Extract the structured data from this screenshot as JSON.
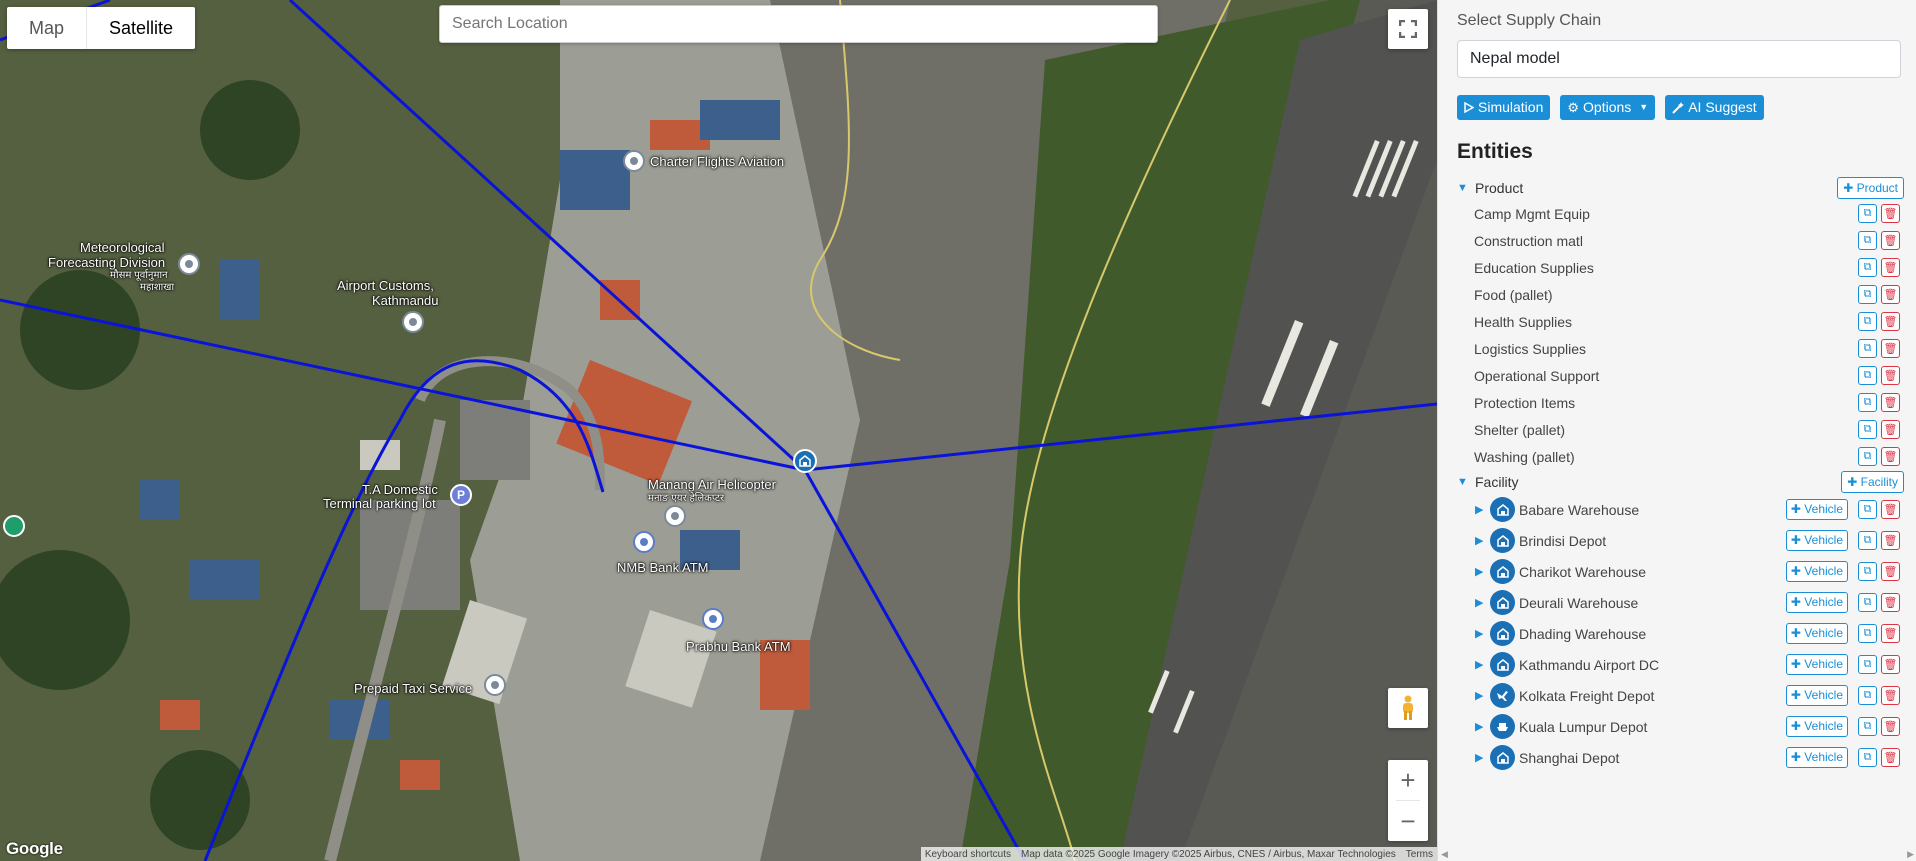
{
  "map": {
    "toggle": {
      "map": "Map",
      "satellite": "Satellite"
    },
    "search_placeholder": "Search Location",
    "labels": {
      "charter": "Charter Flights Aviation",
      "met_line1": "Meteorological",
      "met_line2": "Forecasting Division",
      "met_line3": "मौसम पूर्वानुमान",
      "met_line4": "महाशाखा",
      "customs_line1": "Airport Customs,",
      "customs_line2": "Kathmandu",
      "domestic_line1": "T.A Domestic",
      "domestic_line2": "Terminal parking lot",
      "manang_line1": "Manang Air Helicopter",
      "manang_line2": "मनाङ एयर हेलिकप्टर",
      "nmb": "NMB Bank ATM",
      "prabhu": "Prabhu Bank ATM",
      "taxi": "Prepaid Taxi Service"
    },
    "parking_glyph": "P",
    "google_logo": "Google",
    "attribution": {
      "shortcuts": "Keyboard shortcuts",
      "data": "Map data ©2025 Google Imagery ©2025 Airbus, CNES / Airbus, Maxar Technologies",
      "terms": "Terms"
    },
    "controls": {
      "zoom_in": "+",
      "zoom_out": "−"
    },
    "route_color": "#0a14d8",
    "facility_marker_color": "#1a6fb5"
  },
  "panel": {
    "select_label": "Select Supply Chain",
    "selected_chain": "Nepal model",
    "buttons": {
      "simulation": "Simulation",
      "options": "Options",
      "ai_suggest": "AI Suggest"
    },
    "entities_title": "Entities",
    "product_section": {
      "title": "Product",
      "add_label": "Product"
    },
    "products": [
      "Camp Mgmt Equip",
      "Construction matl",
      "Education Supplies",
      "Food (pallet)",
      "Health Supplies",
      "Logistics Supplies",
      "Operational Support",
      "Protection Items",
      "Shelter (pallet)",
      "Washing (pallet)"
    ],
    "facility_section": {
      "title": "Facility",
      "add_label": "Facility"
    },
    "facilities": [
      {
        "name": "Babare Warehouse",
        "icon": "warehouse-icon"
      },
      {
        "name": "Brindisi Depot",
        "icon": "warehouse-icon"
      },
      {
        "name": "Charikot Warehouse",
        "icon": "warehouse-icon"
      },
      {
        "name": "Deurali Warehouse",
        "icon": "warehouse-icon"
      },
      {
        "name": "Dhading Warehouse",
        "icon": "warehouse-icon"
      },
      {
        "name": "Kathmandu Airport DC",
        "icon": "warehouse-icon"
      },
      {
        "name": "Kolkata Freight Depot",
        "icon": "plane-icon"
      },
      {
        "name": "Kuala Lumpur Depot",
        "icon": "ship-icon"
      },
      {
        "name": "Shanghai Depot",
        "icon": "warehouse-icon"
      }
    ],
    "vehicle_label": "Vehicle",
    "accent_color": "#1a8fd8",
    "danger_color": "#dc3545"
  }
}
